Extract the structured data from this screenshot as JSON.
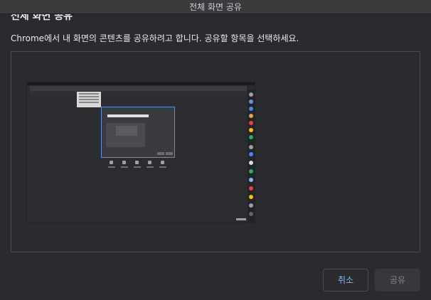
{
  "window": {
    "title": "전체 화면 공유"
  },
  "dialog": {
    "heading": "전체 화면 공유",
    "description": "Chrome에서 내 화면의 콘텐츠를 공유하려고 합니다. 공유할 항목을 선택하세요."
  },
  "buttons": {
    "cancel_label": "취소",
    "share_label": "공유"
  },
  "colors": {
    "background": "#2a2b2e",
    "accent": "#8ab4f8",
    "disabled_text": "#80868b",
    "border": "#4a4c50"
  }
}
